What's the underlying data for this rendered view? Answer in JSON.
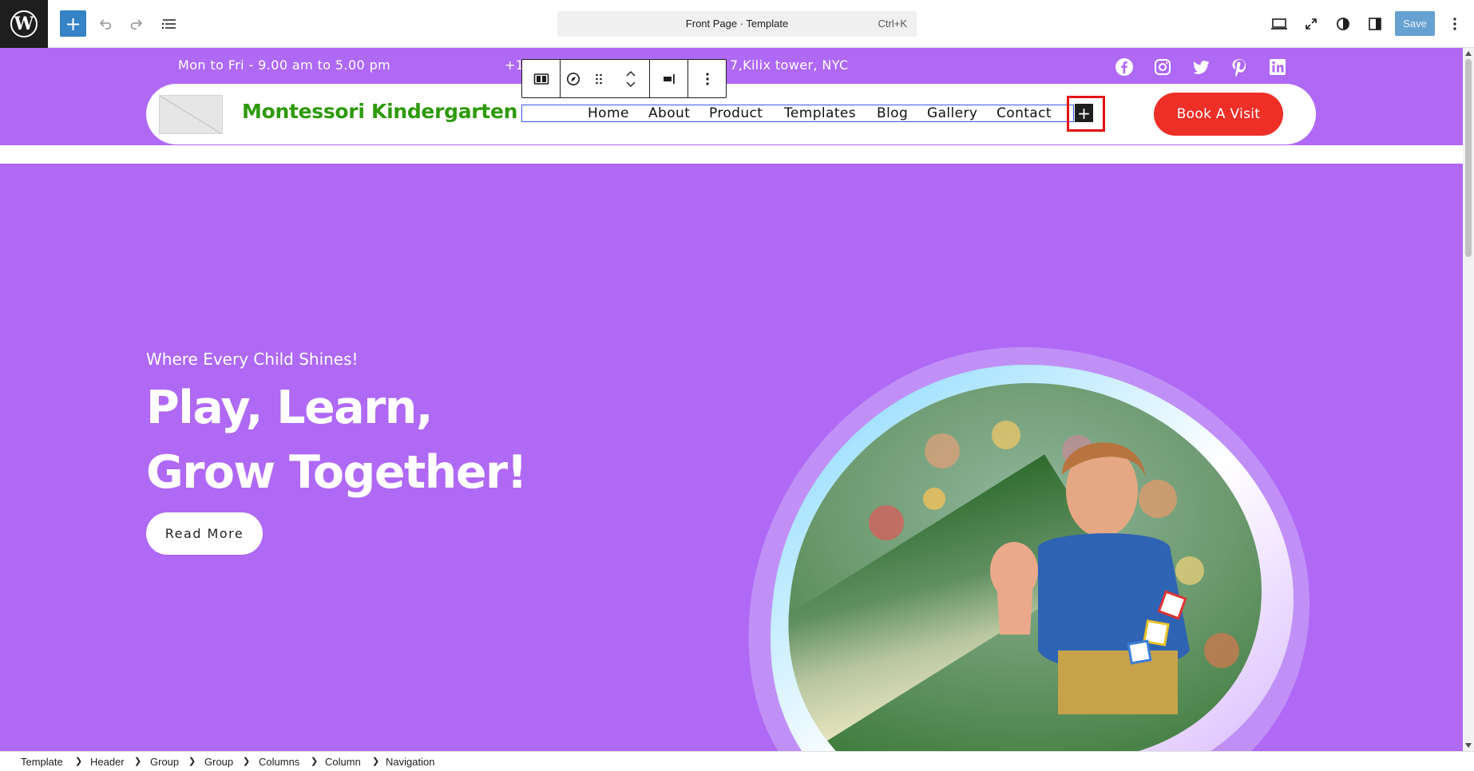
{
  "editor": {
    "logo_letter": "W",
    "command_center": {
      "title": "Front Page · Template",
      "shortcut": "Ctrl+K"
    },
    "save_label": "Save",
    "icons": [
      "wordpress-logo",
      "plus-icon",
      "undo-icon",
      "redo-icon",
      "document-overview-icon",
      "desktop-preview-icon",
      "fullscreen-icon",
      "styles-contrast-icon",
      "settings-sidebar-icon",
      "more-options-icon"
    ],
    "accent_color": "#3582c4"
  },
  "site": {
    "topbar": {
      "hours": "Mon to Fri - 9.00 am to 5.00 pm",
      "address": "+12 (45)...  7,Kilix tower, NYC",
      "address_visible_start": "+1",
      "address_visible_end": "7,Kilix tower, NYC",
      "social": [
        "facebook-icon",
        "instagram-icon",
        "twitter-icon",
        "pinterest-icon",
        "linkedin-icon"
      ]
    },
    "header": {
      "title": "Montessori Kindergarten",
      "nav": [
        "Home",
        "About",
        "Product",
        "Templates",
        "Blog",
        "Gallery",
        "Contact"
      ],
      "cta": "Book A Visit"
    },
    "hero": {
      "kicker": "Where Every Child Shines!",
      "headline_line1": "Play, Learn,",
      "headline_line2": "Grow Together!",
      "button": "Read More"
    },
    "colors": {
      "brand_purple": "#af69f5",
      "title_green": "#2e9a0a",
      "cta_red": "#ed2f28"
    }
  },
  "breadcrumb": [
    "Template",
    "Header",
    "Group",
    "Group",
    "Columns",
    "Column",
    "Navigation"
  ]
}
